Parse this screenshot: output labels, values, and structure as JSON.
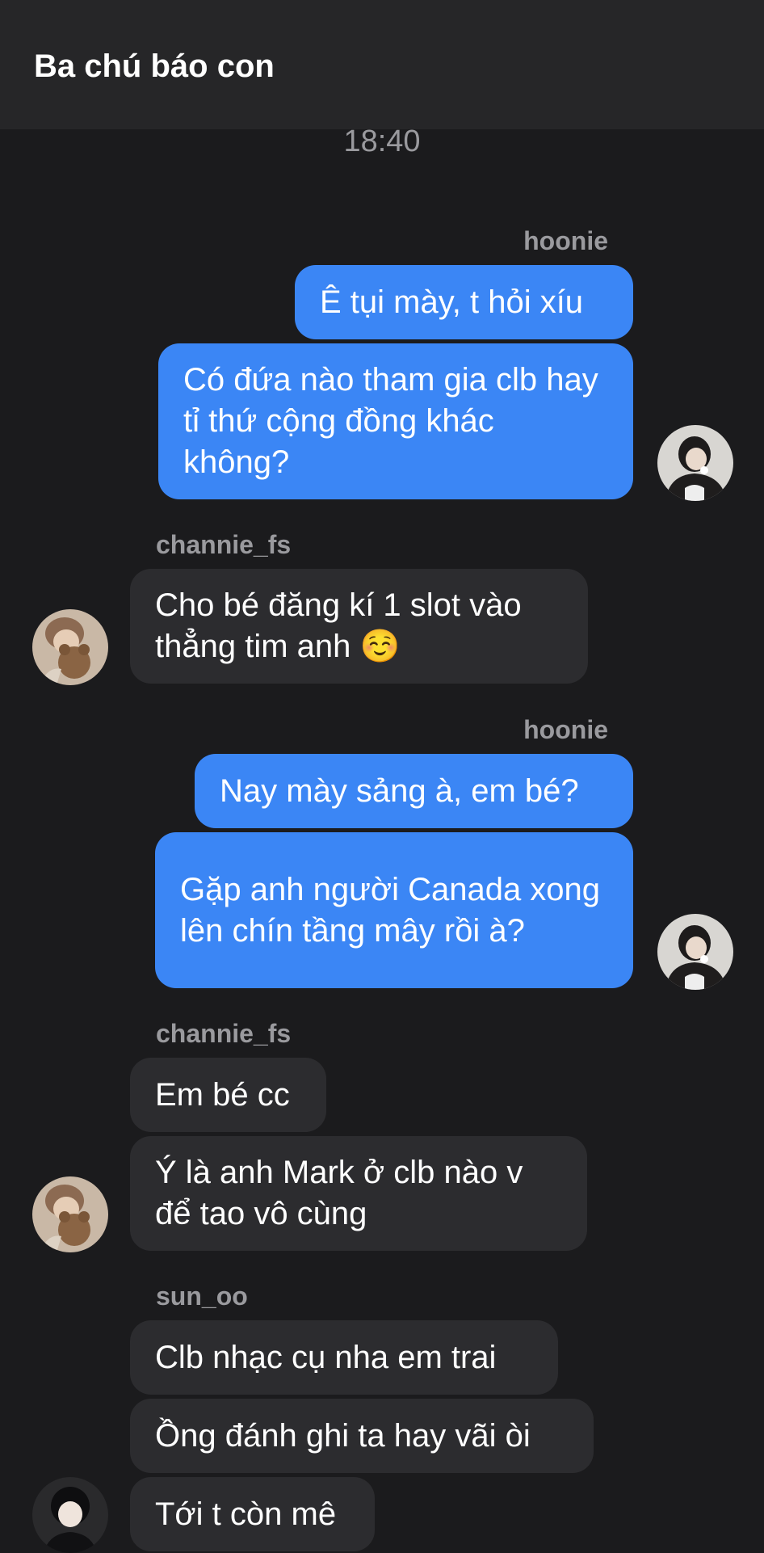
{
  "header": {
    "title": "Ba chú báo con"
  },
  "timestamp": "18:40",
  "messages": [
    {
      "sender": "hoonie",
      "bubbles": [
        "Ê tụi mày, t hỏi xíu",
        "Có đứa nào tham gia clb hay tỉ thứ cộng đồng khác không?"
      ]
    },
    {
      "sender": "channie_fs",
      "bubbles": [
        "Cho bé đăng kí 1 slot vào thẳng tim anh ☺️"
      ]
    },
    {
      "sender": "hoonie",
      "bubbles": [
        "Nay mày sảng à, em bé?",
        "Gặp anh người Canada xong lên chín tầng mây rồi à?"
      ]
    },
    {
      "sender": "channie_fs",
      "bubbles": [
        "Em bé cc",
        "Ý là anh Mark ở clb nào v để tao vô cùng"
      ]
    },
    {
      "sender": "sun_oo",
      "bubbles": [
        "Clb nhạc cụ nha em trai",
        "Ồng đánh ghi ta hay vãi òi",
        "Tới t còn mê"
      ]
    }
  ],
  "colors": {
    "outgoing": "#3b86f5",
    "incoming": "#2c2c2f",
    "background": "#1b1b1d",
    "header": "#262628"
  }
}
